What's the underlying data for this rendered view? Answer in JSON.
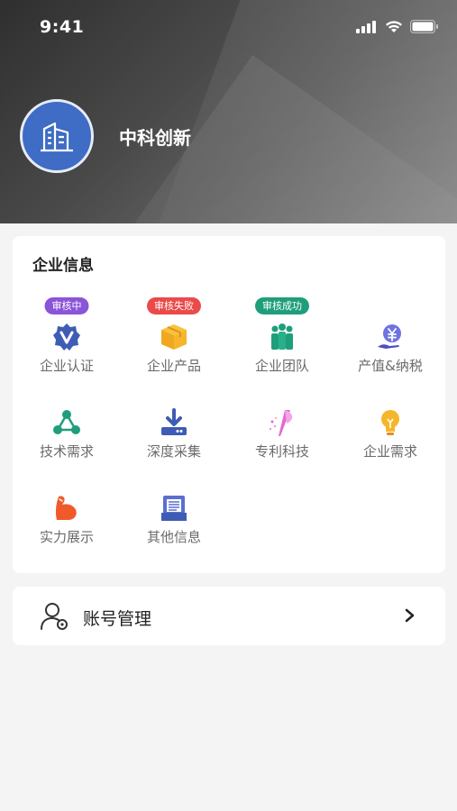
{
  "status": {
    "time": "9:41"
  },
  "profile": {
    "company_name": "中科创新",
    "avatar_icon": "building-icon"
  },
  "enterprise_info": {
    "title": "企业信息",
    "items": [
      {
        "label": "企业认证",
        "icon": "verified-badge-icon",
        "badge": "审核中",
        "badge_color": "#8a55d8"
      },
      {
        "label": "企业产品",
        "icon": "product-box-icon",
        "badge": "审核失败",
        "badge_color": "#ea4a4a"
      },
      {
        "label": "企业团队",
        "icon": "team-icon",
        "badge": "审核成功",
        "badge_color": "#1f9e7b"
      },
      {
        "label": "产值&纳税",
        "icon": "yuan-hand-icon"
      },
      {
        "label": "技术需求",
        "icon": "network-nodes-icon"
      },
      {
        "label": "深度采集",
        "icon": "download-tray-icon"
      },
      {
        "label": "专利科技",
        "icon": "patent-beam-icon"
      },
      {
        "label": "企业需求",
        "icon": "lightbulb-icon"
      },
      {
        "label": "实力展示",
        "icon": "muscle-arm-icon"
      },
      {
        "label": "其他信息",
        "icon": "document-stack-icon"
      }
    ]
  },
  "account": {
    "label": "账号管理",
    "icon": "user-settings-icon"
  }
}
